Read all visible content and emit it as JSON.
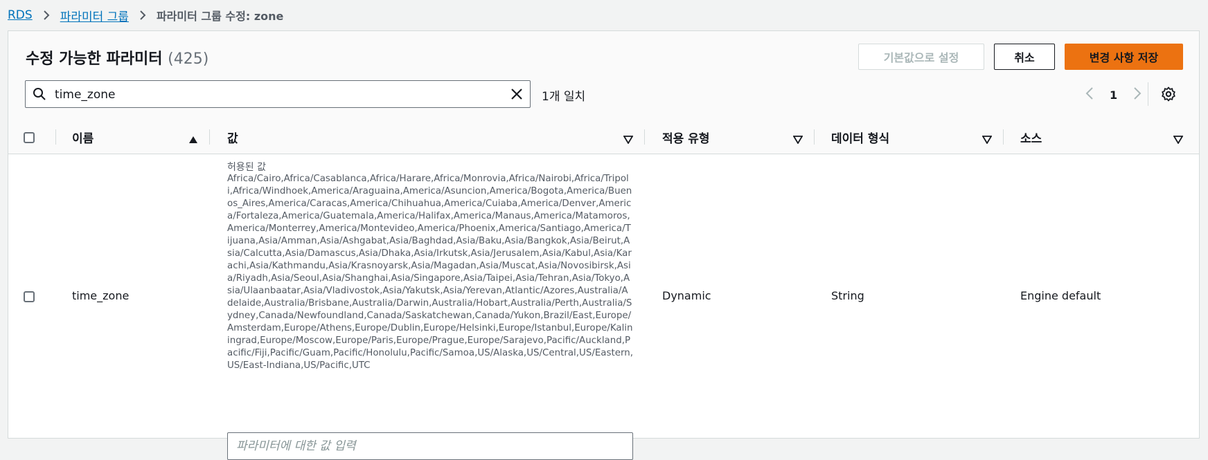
{
  "breadcrumb": {
    "root": "RDS",
    "parent": "파라미터 그룹",
    "current": "파라미터 그룹 수정: zone"
  },
  "panel": {
    "title": "수정 가능한 파라미터",
    "count": "(425)"
  },
  "actions": {
    "reset_label": "기본값으로 설정",
    "cancel_label": "취소",
    "save_label": "변경 사항 저장"
  },
  "search": {
    "value": "time_zone",
    "match_text": "1개 일치"
  },
  "pagination": {
    "current_page": "1"
  },
  "table": {
    "columns": [
      "이름",
      "값",
      "적용 유형",
      "데이터 형식",
      "소스"
    ],
    "rows": [
      {
        "name": "time_zone",
        "allowed_label": "허용된 값",
        "allowed_values": "Africa/Cairo,Africa/Casablanca,Africa/Harare,Africa/Monrovia,Africa/Nairobi,Africa/Tripoli,Africa/Windhoek,America/Araguaina,America/Asuncion,America/Bogota,America/Buenos_Aires,America/Caracas,America/Chihuahua,America/Cuiaba,America/Denver,America/Fortaleza,America/Guatemala,America/Halifax,America/Manaus,America/Matamoros,America/Monterrey,America/Montevideo,America/Phoenix,America/Santiago,America/Tijuana,Asia/Amman,Asia/Ashgabat,Asia/Baghdad,Asia/Baku,Asia/Bangkok,Asia/Beirut,Asia/Calcutta,Asia/Damascus,Asia/Dhaka,Asia/Irkutsk,Asia/Jerusalem,Asia/Kabul,Asia/Karachi,Asia/Kathmandu,Asia/Krasnoyarsk,Asia/Magadan,Asia/Muscat,Asia/Novosibirsk,Asia/Riyadh,Asia/Seoul,Asia/Shanghai,Asia/Singapore,Asia/Taipei,Asia/Tehran,Asia/Tokyo,Asia/Ulaanbaatar,Asia/Vladivostok,Asia/Yakutsk,Asia/Yerevan,Atlantic/Azores,Australia/Adelaide,Australia/Brisbane,Australia/Darwin,Australia/Hobart,Australia/Perth,Australia/Sydney,Canada/Newfoundland,Canada/Saskatchewan,Canada/Yukon,Brazil/East,Europe/Amsterdam,Europe/Athens,Europe/Dublin,Europe/Helsinki,Europe/Istanbul,Europe/Kaliningrad,Europe/Moscow,Europe/Paris,Europe/Prague,Europe/Sarajevo,Pacific/Auckland,Pacific/Fiji,Pacific/Guam,Pacific/Honolulu,Pacific/Samoa,US/Alaska,US/Central,US/Eastern,US/East-Indiana,US/Pacific,UTC",
        "value_placeholder": "파라미터에 대한 값 입력",
        "apply_type": "Dynamic",
        "data_type": "String",
        "source": "Engine default"
      }
    ]
  },
  "colors": {
    "link": "#0073bb",
    "primary": "#ec7211",
    "text": "#16191f",
    "muted": "#545b64"
  }
}
